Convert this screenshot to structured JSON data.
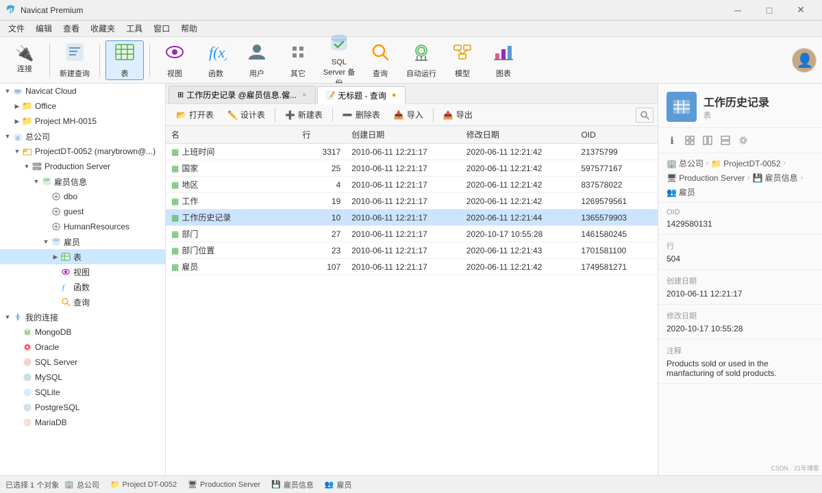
{
  "titleBar": {
    "appName": "Navicat Premium",
    "minimize": "─",
    "maximize": "□",
    "close": "✕"
  },
  "menuBar": {
    "items": [
      "文件",
      "编辑",
      "查看",
      "收藏夹",
      "工具",
      "窗口",
      "帮助"
    ]
  },
  "toolbar": {
    "buttons": [
      {
        "id": "connect",
        "label": "连接",
        "icon": "🔌"
      },
      {
        "id": "new-query",
        "label": "新建查询",
        "icon": "📝"
      },
      {
        "id": "table",
        "label": "表",
        "icon": "⊞"
      },
      {
        "id": "view",
        "label": "视图",
        "icon": "👁"
      },
      {
        "id": "func",
        "label": "函数",
        "icon": "ƒ(x)"
      },
      {
        "id": "user",
        "label": "用户",
        "icon": "👤"
      },
      {
        "id": "other",
        "label": "其它",
        "icon": "🔧"
      },
      {
        "id": "sqlserver-backup",
        "label": "SQL Server 备份",
        "icon": "💾"
      },
      {
        "id": "query",
        "label": "查询",
        "icon": "🔍"
      },
      {
        "id": "autorun",
        "label": "自动运行",
        "icon": "🤖"
      },
      {
        "id": "model",
        "label": "模型",
        "icon": "📐"
      },
      {
        "id": "chart",
        "label": "图表",
        "icon": "📊"
      }
    ]
  },
  "sidebar": {
    "items": [
      {
        "id": "navicat-cloud",
        "label": "Navicat Cloud",
        "level": 0,
        "type": "cloud",
        "expanded": true
      },
      {
        "id": "office",
        "label": "Office",
        "level": 1,
        "type": "folder"
      },
      {
        "id": "project-mh",
        "label": "Project MH-0015",
        "level": 1,
        "type": "folder"
      },
      {
        "id": "company",
        "label": "总公司",
        "level": 0,
        "type": "company",
        "expanded": true
      },
      {
        "id": "projectdt",
        "label": "ProjectDT-0052 (marybrown@...)",
        "level": 1,
        "type": "project",
        "expanded": true
      },
      {
        "id": "prod-server",
        "label": "Production Server",
        "level": 2,
        "type": "server",
        "expanded": true
      },
      {
        "id": "employees",
        "label": "雇员信息",
        "level": 3,
        "type": "db",
        "expanded": true
      },
      {
        "id": "dbo",
        "label": "dbo",
        "level": 4,
        "type": "schema"
      },
      {
        "id": "guest",
        "label": "guest",
        "level": 4,
        "type": "schema"
      },
      {
        "id": "humanresources",
        "label": "HumanResources",
        "level": 4,
        "type": "schema"
      },
      {
        "id": "employees-group",
        "label": "雇员",
        "level": 4,
        "type": "db2",
        "expanded": true
      },
      {
        "id": "tables",
        "label": "表",
        "level": 5,
        "type": "tables",
        "selected": true
      },
      {
        "id": "views",
        "label": "视图",
        "level": 5,
        "type": "views"
      },
      {
        "id": "functions",
        "label": "函数",
        "level": 5,
        "type": "functions"
      },
      {
        "id": "queries",
        "label": "查询",
        "level": 5,
        "type": "queries"
      },
      {
        "id": "my-connections",
        "label": "我的连接",
        "level": 0,
        "type": "connections",
        "expanded": true
      },
      {
        "id": "mongodb",
        "label": "MongoDB",
        "level": 1,
        "type": "mongo"
      },
      {
        "id": "oracle",
        "label": "Oracle",
        "level": 1,
        "type": "oracle"
      },
      {
        "id": "sqlserver",
        "label": "SQL Server",
        "level": 1,
        "type": "sqlserver"
      },
      {
        "id": "mysql",
        "label": "MySQL",
        "level": 1,
        "type": "mysql"
      },
      {
        "id": "sqlite",
        "label": "SQLite",
        "level": 1,
        "type": "sqlite"
      },
      {
        "id": "postgresql",
        "label": "PostgreSQL",
        "level": 1,
        "type": "pgsql"
      },
      {
        "id": "mariadb",
        "label": "MariaDB",
        "level": 1,
        "type": "maria"
      }
    ]
  },
  "tabs": [
    {
      "id": "workhistory",
      "label": "工作历史记录 @雇员信息.僱...",
      "active": false,
      "icon": "⊞",
      "modified": false
    },
    {
      "id": "untitled-query",
      "label": "无标题 - 查询",
      "active": true,
      "icon": "📝",
      "modified": true
    }
  ],
  "objectToolbar": {
    "buttons": [
      {
        "id": "open-table",
        "label": "打开表",
        "icon": "📂"
      },
      {
        "id": "design-table",
        "label": "设计表",
        "icon": "✏️"
      },
      {
        "id": "new-table",
        "label": "新建表",
        "icon": "➕"
      },
      {
        "id": "delete-table",
        "label": "删除表",
        "icon": "➖"
      },
      {
        "id": "import",
        "label": "导入",
        "icon": "📥"
      },
      {
        "id": "export",
        "label": "导出",
        "icon": "📤"
      }
    ]
  },
  "tableColumns": [
    "名",
    "行",
    "创建日期",
    "修改日期",
    "OID"
  ],
  "tableRows": [
    {
      "name": "上班时间",
      "rows": "3317",
      "created": "2010-06-11 12:21:17",
      "modified": "2020-06-11 12:21:42",
      "oid": "21375799"
    },
    {
      "name": "国家",
      "rows": "25",
      "created": "2010-06-11 12:21:17",
      "modified": "2020-06-11 12:21:42",
      "oid": "597577167"
    },
    {
      "name": "地区",
      "rows": "4",
      "created": "2010-06-11 12:21:17",
      "modified": "2020-06-11 12:21:42",
      "oid": "837578022"
    },
    {
      "name": "工作",
      "rows": "19",
      "created": "2010-06-11 12:21:17",
      "modified": "2020-06-11 12:21:42",
      "oid": "1269579561"
    },
    {
      "name": "工作历史记录",
      "rows": "10",
      "created": "2010-06-11 12:21:17",
      "modified": "2020-06-11 12:21:44",
      "oid": "1365579903",
      "selected": true
    },
    {
      "name": "部门",
      "rows": "27",
      "created": "2010-06-11 12:21:17",
      "modified": "2020-10-17 10:55:28",
      "oid": "1461580245"
    },
    {
      "name": "部门位置",
      "rows": "23",
      "created": "2010-06-11 12:21:17",
      "modified": "2020-06-11 12:21:43",
      "oid": "1701581100"
    },
    {
      "name": "雇员",
      "rows": "107",
      "created": "2010-06-11 12:21:17",
      "modified": "2020-06-11 12:21:42",
      "oid": "1749581271"
    }
  ],
  "rightPanel": {
    "title": "工作历史记录",
    "subtitle": "表",
    "breadcrumbs": [
      {
        "icon": "🏢",
        "label": "总公司"
      },
      {
        "icon": "📁",
        "label": "ProjectDT-0052"
      },
      {
        "icon": "🖥",
        "label": "Production Server"
      },
      {
        "icon": "💾",
        "label": "雇员信息"
      },
      {
        "icon": "👥",
        "label": "雇员"
      }
    ],
    "oid": {
      "label": "OID",
      "value": "1429580131"
    },
    "rows": {
      "label": "行",
      "value": "504"
    },
    "createdDate": {
      "label": "创建日期",
      "value": "2010-06-11 12:21:17"
    },
    "modifiedDate": {
      "label": "修改日期",
      "value": "2020-10-17 10:55:28"
    },
    "comment": {
      "label": "注释",
      "value": "Products sold or used in the manfacturing of sold products."
    },
    "toolIcons": [
      "ℹ",
      "⊞",
      "⊟",
      "⊠",
      "⚙"
    ]
  },
  "statusBar": {
    "items": [
      {
        "icon": "🏢",
        "label": "总公司"
      },
      {
        "icon": "📁",
        "label": "Project DT-0052"
      },
      {
        "icon": "🖥",
        "label": "Production Server"
      },
      {
        "icon": "💾",
        "label": "雇员信息"
      },
      {
        "icon": "👥",
        "label": "雇员"
      }
    ],
    "selected": "已选择 1 个对象"
  }
}
